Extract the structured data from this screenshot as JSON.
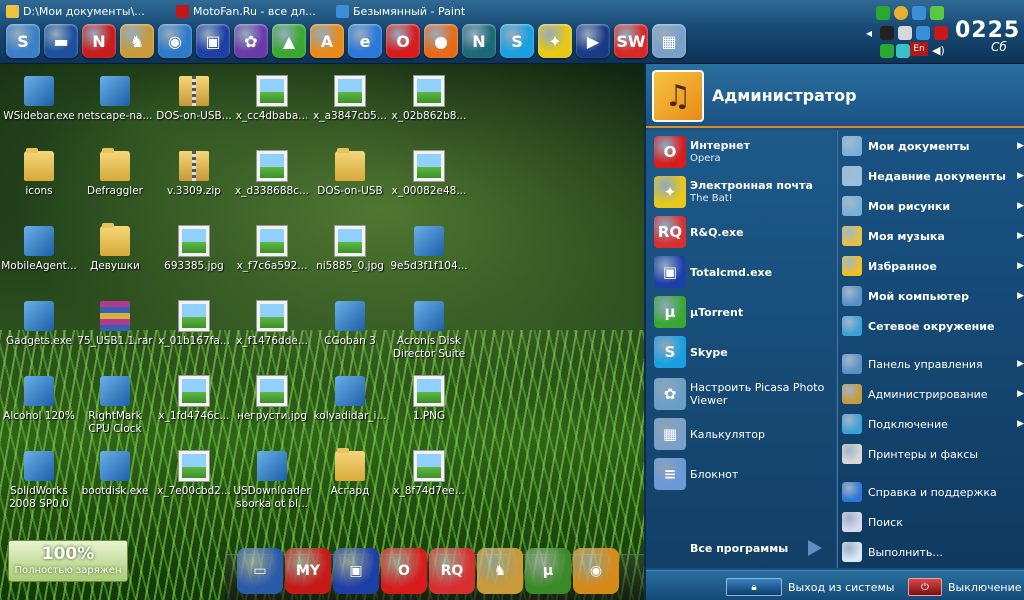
{
  "taskbar": {
    "windows": [
      {
        "title": "D:\\Мои документы\\...",
        "color": "#f0c040"
      },
      {
        "title": "MotoFan.Ru - все дл...",
        "color": "#c01818"
      },
      {
        "title": "Безымянный - Paint",
        "color": "#3a8fd8"
      }
    ],
    "quick_launch": [
      {
        "icon": "sidebar-icon",
        "glyph": "S",
        "color": "#3a7fc8"
      },
      {
        "icon": "window-icon",
        "glyph": "▬",
        "color": "#1c4fa0"
      },
      {
        "icon": "netscape-icon",
        "glyph": "N",
        "color": "#c81c1c"
      },
      {
        "icon": "coyote-icon",
        "glyph": "♞",
        "color": "#c89a3a"
      },
      {
        "icon": "network-globe-icon",
        "glyph": "◉",
        "color": "#2c7ac8"
      },
      {
        "icon": "floppy-icon",
        "glyph": "▣",
        "color": "#1e3ea8"
      },
      {
        "icon": "picasa-icon",
        "glyph": "✿",
        "color": "#6a3aa8"
      },
      {
        "icon": "utorrent-green-icon",
        "glyph": "▲",
        "color": "#3aa830"
      },
      {
        "icon": "aimp-icon",
        "glyph": "A",
        "color": "#e88a18"
      },
      {
        "icon": "internet-explorer-icon",
        "glyph": "e",
        "color": "#2a78d8"
      },
      {
        "icon": "opera-icon",
        "glyph": "O",
        "color": "#d81c1c"
      },
      {
        "icon": "firefox-icon",
        "glyph": "●",
        "color": "#e86a18"
      },
      {
        "icon": "netscape-n-icon",
        "glyph": "N",
        "color": "#1c6a78"
      },
      {
        "icon": "skype-icon",
        "glyph": "S",
        "color": "#1aa0e0"
      },
      {
        "icon": "the-bat-icon",
        "glyph": "✦",
        "color": "#e8c818"
      },
      {
        "icon": "kmplayer-icon",
        "glyph": "▶",
        "color": "#1a3a88"
      },
      {
        "icon": "solidworks-icon",
        "glyph": "SW",
        "color": "#d82828"
      },
      {
        "icon": "calculator-icon",
        "glyph": "▦",
        "color": "#7aa0c8"
      }
    ],
    "clock_time": "0225",
    "clock_day": "Сб",
    "language": "En"
  },
  "desktop": {
    "icons": [
      {
        "label": "WSidebar.exe",
        "type": "exe"
      },
      {
        "label": "netscape-na...",
        "type": "exe"
      },
      {
        "label": "DOS-on-USB...",
        "type": "zip"
      },
      {
        "label": "x_cc4dbaba...",
        "type": "picture"
      },
      {
        "label": "x_a3847cb5...",
        "type": "picture"
      },
      {
        "label": "x_02b862b8...",
        "type": "picture"
      },
      {
        "label": "icons",
        "type": "folder"
      },
      {
        "label": "Defraggler",
        "type": "folder"
      },
      {
        "label": "v.3309.zip",
        "type": "zip"
      },
      {
        "label": "x_d338688c...",
        "type": "picture"
      },
      {
        "label": "DOS-on-USB",
        "type": "folder"
      },
      {
        "label": "x_00082e48...",
        "type": "picture"
      },
      {
        "label": "MobileAgent...",
        "type": "exe"
      },
      {
        "label": "Девушки",
        "type": "folder"
      },
      {
        "label": "693385.jpg",
        "type": "picture"
      },
      {
        "label": "x_f7c6a592...",
        "type": "picture"
      },
      {
        "label": "ni5885_0.jpg",
        "type": "picture"
      },
      {
        "label": "9e5d3f1f104...",
        "type": "exe"
      },
      {
        "label": "Gadgets.exe",
        "type": "exe"
      },
      {
        "label": "75_USB1.1.rar",
        "type": "rar"
      },
      {
        "label": "x_01b167fa...",
        "type": "picture"
      },
      {
        "label": "x_f1476dde...",
        "type": "picture"
      },
      {
        "label": "CGoban 3",
        "type": "exe"
      },
      {
        "label": "Acronis Disk Director Suite",
        "type": "exe"
      },
      {
        "label": "Alcohol 120%",
        "type": "exe"
      },
      {
        "label": "RightMark CPU Clock Utility",
        "type": "exe"
      },
      {
        "label": "x_1fd4746c...",
        "type": "picture"
      },
      {
        "label": "негрусти.jpg",
        "type": "picture"
      },
      {
        "label": "kolyadidar_i...",
        "type": "exe"
      },
      {
        "label": "1.PNG",
        "type": "picture"
      },
      {
        "label": "SolidWorks 2008 SP0.0",
        "type": "exe"
      },
      {
        "label": "bootdisk.exe",
        "type": "exe"
      },
      {
        "label": "x_7e00cbd2...",
        "type": "picture"
      },
      {
        "label": "USDownloader sborka ot bl...",
        "type": "exe"
      },
      {
        "label": "Асгард",
        "type": "folder"
      },
      {
        "label": "x_8f74d7ee...",
        "type": "picture"
      }
    ],
    "battery": {
      "percent": "100%",
      "status": "Полностью заряжен"
    },
    "dock": [
      {
        "icon": "computer-icon",
        "glyph": "▭",
        "color": "#2a5aa8"
      },
      {
        "icon": "my-docs-icon",
        "glyph": "MY",
        "color": "#c81818"
      },
      {
        "icon": "floppy-icon",
        "glyph": "▣",
        "color": "#1e3ea8"
      },
      {
        "icon": "opera-icon",
        "glyph": "O",
        "color": "#d81c1c"
      },
      {
        "icon": "rq-icon",
        "glyph": "RQ",
        "color": "#d83030"
      },
      {
        "icon": "coyote-icon",
        "glyph": "♞",
        "color": "#c89a3a"
      },
      {
        "icon": "utorrent-icon",
        "glyph": "µ",
        "color": "#3a8a28"
      },
      {
        "icon": "globe-icon",
        "glyph": "◉",
        "color": "#d88a18"
      }
    ]
  },
  "start_menu": {
    "username": "Администратор",
    "programs": [
      {
        "main": "Интернет",
        "sub": "Opera",
        "icon": "opera-icon",
        "glyph": "O",
        "color": "#d81c1c",
        "bold": true
      },
      {
        "main": "Электронная почта",
        "sub": "The Bat!",
        "icon": "the-bat-icon",
        "glyph": "✦",
        "color": "#e8c818",
        "bold": true
      },
      {
        "main": "R&Q.exe",
        "sub": "",
        "icon": "rq-icon",
        "glyph": "RQ",
        "color": "#d83030",
        "bold": true
      },
      {
        "main": "Totalcmd.exe",
        "sub": "",
        "icon": "floppy-icon",
        "glyph": "▣",
        "color": "#1e3ea8",
        "bold": true
      },
      {
        "main": "µTorrent",
        "sub": "",
        "icon": "utorrent-icon",
        "glyph": "µ",
        "color": "#3aa830",
        "bold": true
      },
      {
        "main": "Skype",
        "sub": "",
        "icon": "skype-icon",
        "glyph": "S",
        "color": "#1aa0e0",
        "bold": true
      },
      {
        "main": "Настроить Picasa Photo Viewer",
        "sub": "",
        "icon": "picasa-viewer-icon",
        "glyph": "✿",
        "color": "#6aa0c8",
        "bold": false
      },
      {
        "main": "Калькулятор",
        "sub": "",
        "icon": "calculator-icon",
        "glyph": "▦",
        "color": "#7aa0c8",
        "bold": false
      },
      {
        "main": "Блокнот",
        "sub": "",
        "icon": "notepad-icon",
        "glyph": "≡",
        "color": "#6a98d8",
        "bold": false
      }
    ],
    "all_programs": "Все программы",
    "places": [
      {
        "label": "Мои документы",
        "icon": "my-documents-icon",
        "color": "#7ab0d8",
        "bold": true,
        "arrow": "▶"
      },
      {
        "label": "Недавние документы",
        "icon": "recent-documents-icon",
        "color": "#9ac0e0",
        "bold": true,
        "arrow": "▶"
      },
      {
        "label": "Мои рисунки",
        "icon": "my-pictures-icon",
        "color": "#7ab0d8",
        "bold": true,
        "arrow": "▶"
      },
      {
        "label": "Моя музыка",
        "icon": "my-music-icon",
        "color": "#e8c040",
        "bold": true,
        "arrow": "▶"
      },
      {
        "label": "Избранное",
        "icon": "favorites-icon",
        "color": "#f0c020",
        "bold": true,
        "arrow": "▶"
      },
      {
        "label": "Мой компьютер",
        "icon": "my-computer-icon",
        "color": "#5a90c8",
        "bold": true,
        "arrow": "▶"
      },
      {
        "label": "Сетевое окружение",
        "icon": "network-icon",
        "color": "#3aa0d8",
        "bold": true,
        "arrow": ""
      },
      {
        "label": "Панель управления",
        "icon": "control-panel-icon",
        "color": "#5a90c8",
        "bold": false,
        "arrow": "▶"
      },
      {
        "label": "Администрирование",
        "icon": "administration-icon",
        "color": "#c89a3a",
        "bold": false,
        "arrow": "▶"
      },
      {
        "label": "Подключение",
        "icon": "connection-icon",
        "color": "#3aa0d8",
        "bold": false,
        "arrow": "▶"
      },
      {
        "label": "Принтеры и факсы",
        "icon": "printers-icon",
        "color": "#d8d8d8",
        "bold": false,
        "arrow": ""
      },
      {
        "label": "Справка и поддержка",
        "icon": "help-icon",
        "color": "#2a78d8",
        "bold": false,
        "arrow": ""
      },
      {
        "label": "Поиск",
        "icon": "search-icon",
        "color": "#d8d8f0",
        "bold": false,
        "arrow": ""
      },
      {
        "label": "Выполнить...",
        "icon": "run-icon",
        "color": "#d8e8f8",
        "bold": false,
        "arrow": ""
      }
    ],
    "logoff": "Выход из системы",
    "shutdown": "Выключение"
  }
}
